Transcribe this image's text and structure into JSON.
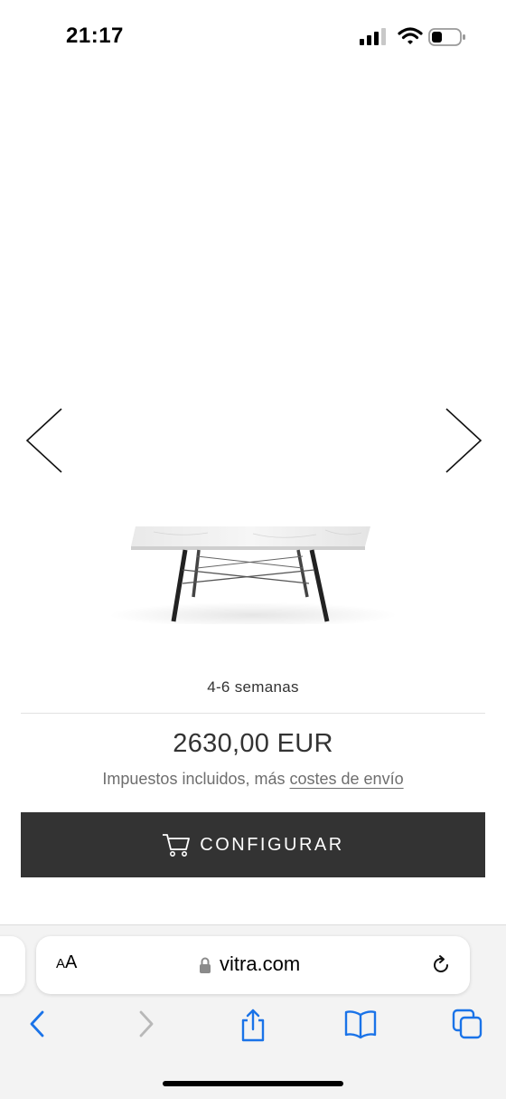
{
  "status_bar": {
    "time": "21:17",
    "icons": [
      "signal-icon",
      "wifi-icon",
      "battery-icon"
    ]
  },
  "carousel": {
    "prev_icon": "chevron-left-icon",
    "next_icon": "chevron-right-icon"
  },
  "product": {
    "delivery_time": "4-6 semanas",
    "price": "2630,00 EUR",
    "tax_prefix": "Impuestos incluidos, más ",
    "shipping_link": "costes de envío"
  },
  "cta": {
    "label": "CONFIGURAR",
    "icon": "cart-icon",
    "background": "#333333"
  },
  "safari": {
    "aa_small": "A",
    "aa_large": "A",
    "url": "vitra.com",
    "accent": "#1a73e8"
  }
}
